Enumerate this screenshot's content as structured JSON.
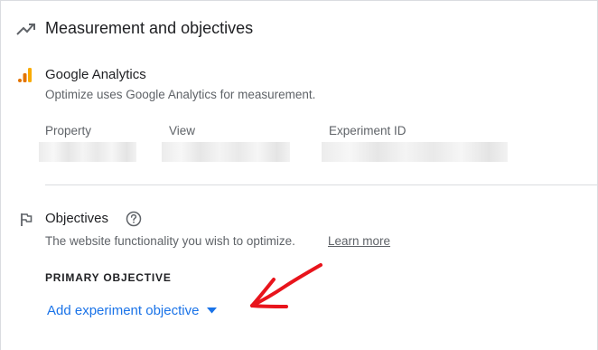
{
  "measurement": {
    "title": "Measurement and objectives",
    "icon": "trending-up-icon"
  },
  "analytics": {
    "title": "Google Analytics",
    "description": "Optimize uses Google Analytics for measurement.",
    "icon": "analytics-bars-icon",
    "icon_colors": [
      "#f9ab00",
      "#e37400"
    ],
    "fields": [
      {
        "label": "Property"
      },
      {
        "label": "View"
      },
      {
        "label": "Experiment ID"
      }
    ]
  },
  "objectives": {
    "title": "Objectives",
    "icon": "flag-icon",
    "help_icon": "help-circle-icon",
    "description": "The website functionality you wish to optimize.",
    "learn_more": "Learn more",
    "primary_label": "PRIMARY OBJECTIVE",
    "add_objective": "Add experiment objective",
    "dropdown_icon": "caret-down-icon",
    "accent_color": "#1a73e8",
    "annotation_color": "#e8141c"
  }
}
